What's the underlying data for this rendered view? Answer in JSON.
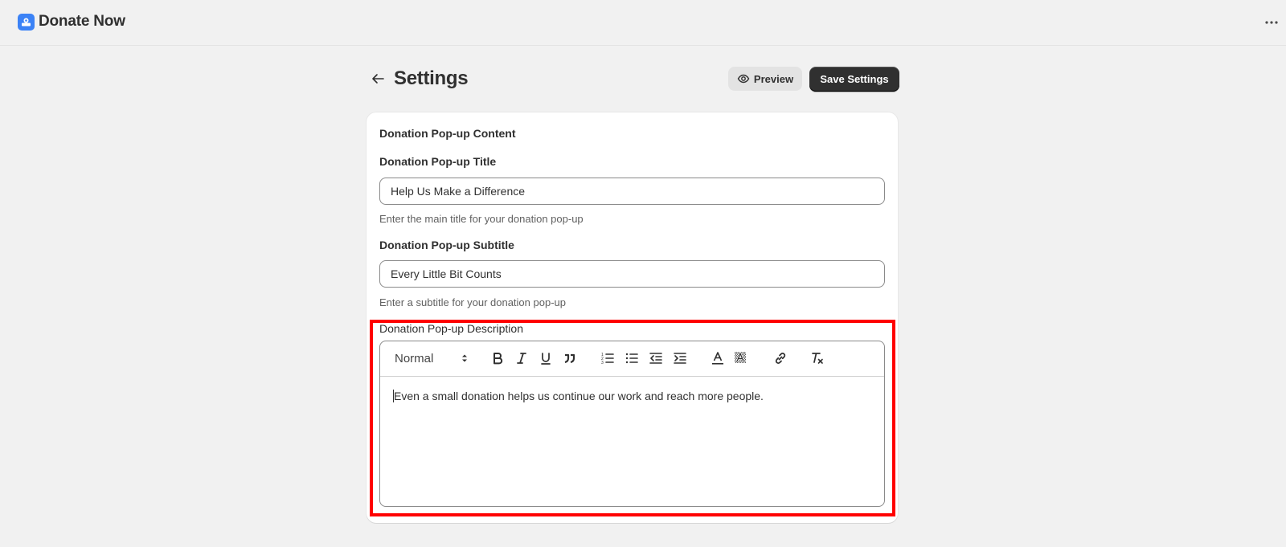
{
  "app": {
    "title": "Donate Now"
  },
  "header": {
    "page_title": "Settings",
    "preview_label": "Preview",
    "save_label": "Save Settings"
  },
  "card": {
    "heading": "Donation Pop-up Content",
    "title_field": {
      "label": "Donation Pop-up Title",
      "value": "Help Us Make a Difference",
      "help": "Enter the main title for your donation pop-up"
    },
    "subtitle_field": {
      "label": "Donation Pop-up Subtitle",
      "value": "Every Little Bit Counts",
      "help": "Enter a subtitle for your donation pop-up"
    },
    "description_field": {
      "label": "Donation Pop-up Description",
      "format_value": "Normal",
      "content": "Even a small donation helps us continue our work and reach more people."
    }
  },
  "colors": {
    "background": "#f1f1f1",
    "primary_button": "#303030",
    "highlight": "#ff0000",
    "logo": "#3b82f6"
  }
}
